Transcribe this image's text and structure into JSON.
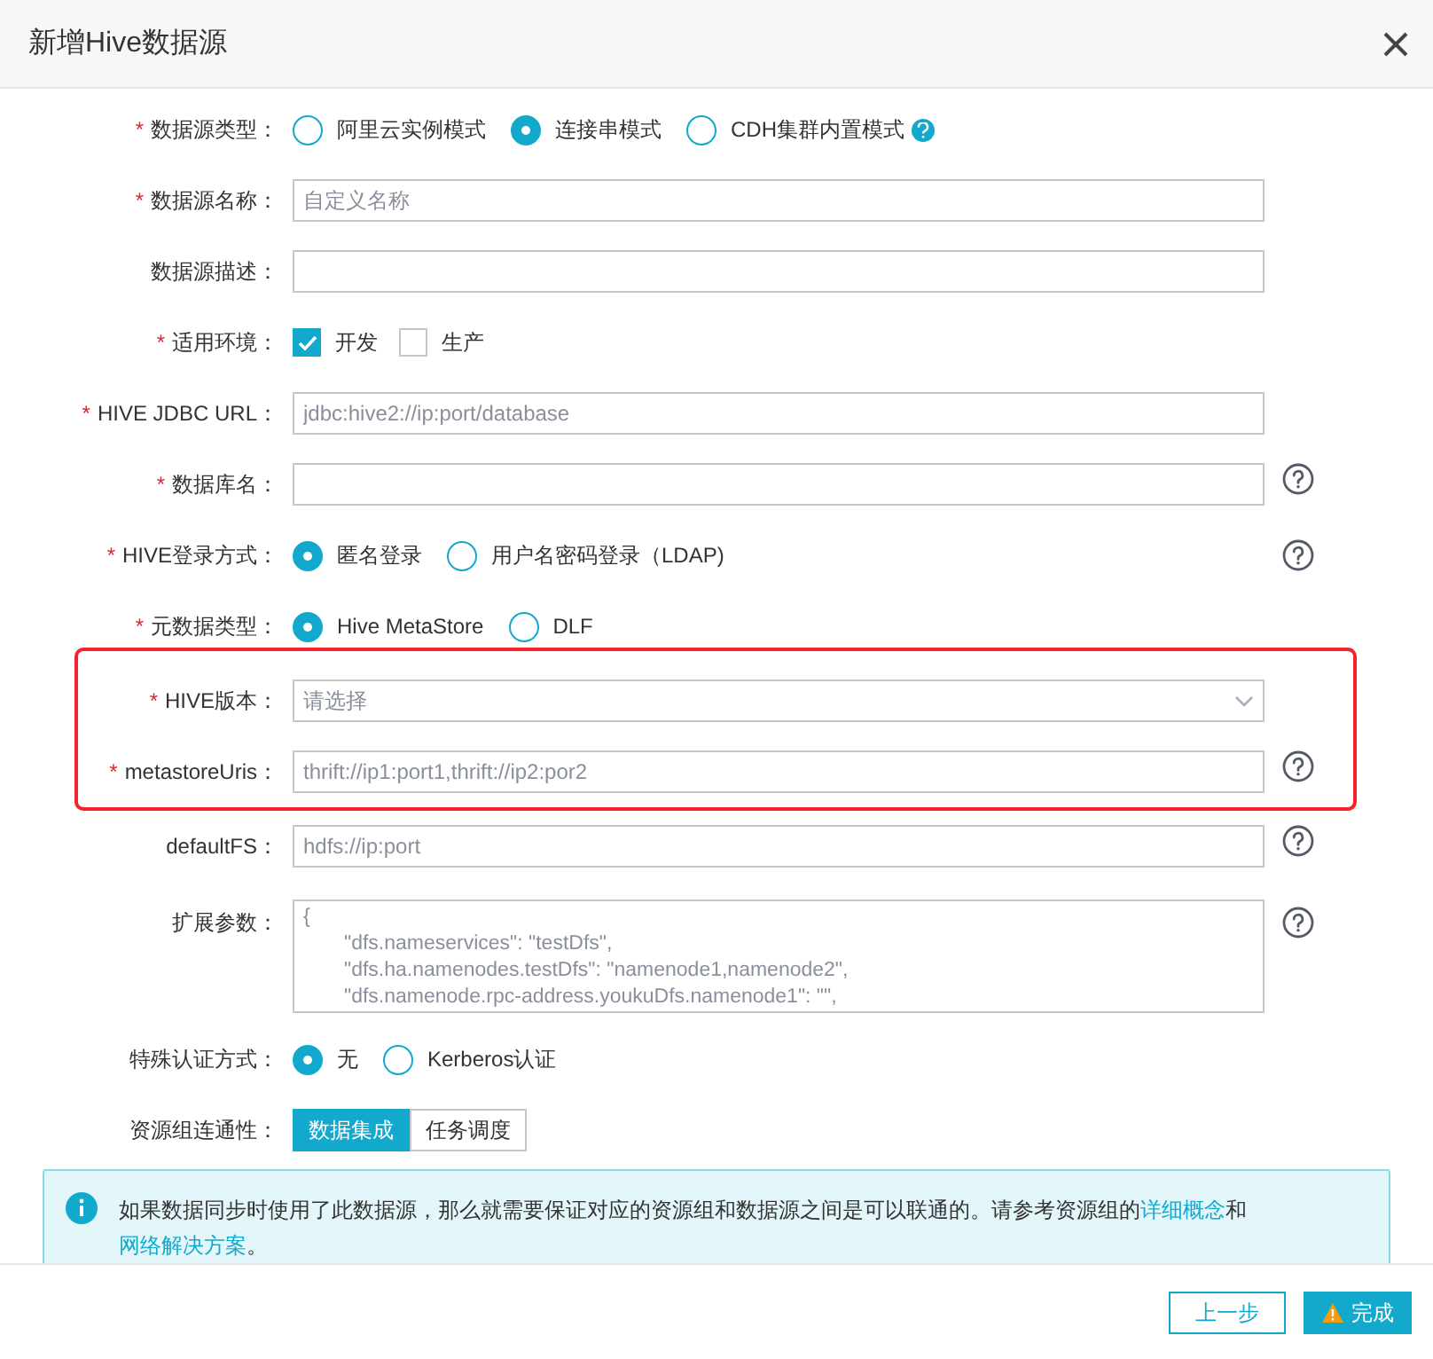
{
  "dialog": {
    "title": "新增Hive数据源"
  },
  "fields": [
    {
      "kind": "radio",
      "required_mark": "*",
      "label": "数据源类型：",
      "help": false,
      "highlighted": false,
      "options": [
        {
          "label": "阿里云实例模式",
          "selected": false,
          "help": false
        },
        {
          "label": "连接串模式",
          "selected": true,
          "help": false
        },
        {
          "label": "CDH集群内置模式",
          "selected": false,
          "help": true
        }
      ]
    },
    {
      "kind": "input",
      "required_mark": "*",
      "label": "数据源名称：",
      "placeholder": "自定义名称",
      "help": false,
      "highlighted": false
    },
    {
      "kind": "input",
      "label": "数据源描述：",
      "help": false,
      "highlighted": false
    },
    {
      "kind": "checkbox",
      "required_mark": "*",
      "label": "适用环境：",
      "help": false,
      "highlighted": false,
      "options": [
        {
          "label": "开发",
          "checked": true
        },
        {
          "label": "生产",
          "checked": false
        }
      ]
    },
    {
      "kind": "input",
      "required_mark": "*",
      "label": "HIVE JDBC URL：",
      "placeholder": "jdbc:hive2://ip:port/database",
      "help": false,
      "highlighted": false
    },
    {
      "kind": "input",
      "required_mark": "*",
      "label": "数据库名：",
      "help": true,
      "highlighted": false
    },
    {
      "kind": "radio",
      "required_mark": "*",
      "label": "HIVE登录方式：",
      "help": true,
      "highlighted": false,
      "options": [
        {
          "label": "匿名登录",
          "selected": true,
          "help": false
        },
        {
          "label": "用户名密码登录（LDAP)",
          "selected": false,
          "help": false
        }
      ]
    },
    {
      "kind": "radio",
      "required_mark": "*",
      "label": "元数据类型：",
      "help": false,
      "highlighted": false,
      "options": [
        {
          "label": "Hive MetaStore",
          "selected": true,
          "help": false
        },
        {
          "label": "DLF",
          "selected": false,
          "help": false
        }
      ]
    },
    {
      "kind": "select",
      "required_mark": "*",
      "label": "HIVE版本：",
      "placeholder": "请选择",
      "help": false,
      "highlighted": true
    },
    {
      "kind": "input",
      "required_mark": "*",
      "label": "metastoreUris：",
      "placeholder": "thrift://ip1:port1,thrift://ip2:por2",
      "help": true,
      "highlighted": true
    },
    {
      "kind": "input",
      "label": "defaultFS：",
      "placeholder": "hdfs://ip:port",
      "help": true,
      "highlighted": false
    },
    {
      "kind": "textarea",
      "label": "扩展参数：",
      "help": true,
      "highlighted": false,
      "placeholder_lines": [
        "{",
        "\"dfs.nameservices\": \"testDfs\",",
        "\"dfs.ha.namenodes.testDfs\": \"namenode1,namenode2\",",
        "\"dfs.namenode.rpc-address.youkuDfs.namenode1\": \"\","
      ]
    },
    {
      "kind": "radio",
      "label": "特殊认证方式：",
      "help": false,
      "highlighted": false,
      "options": [
        {
          "label": "无",
          "selected": true,
          "help": false
        },
        {
          "label": "Kerberos认证",
          "selected": false,
          "help": false
        }
      ]
    },
    {
      "kind": "segmented",
      "label": "资源组连通性：",
      "help": false,
      "highlighted": false,
      "options": [
        {
          "label": "数据集成",
          "selected": true
        },
        {
          "label": "任务调度",
          "selected": false
        }
      ]
    }
  ],
  "notice": {
    "text": "如果数据同步时使用了此数据源，那么就需要保证对应的资源组和数据源之间是可以联通的。请参考资源组的",
    "links": [
      "详细概念",
      "网络解决方案"
    ],
    "joiner": "和",
    "end": "。"
  },
  "footer": {
    "buttons": [
      {
        "label": "上一步",
        "kind": "secondary"
      },
      {
        "label": "完成",
        "kind": "primary"
      }
    ]
  }
}
